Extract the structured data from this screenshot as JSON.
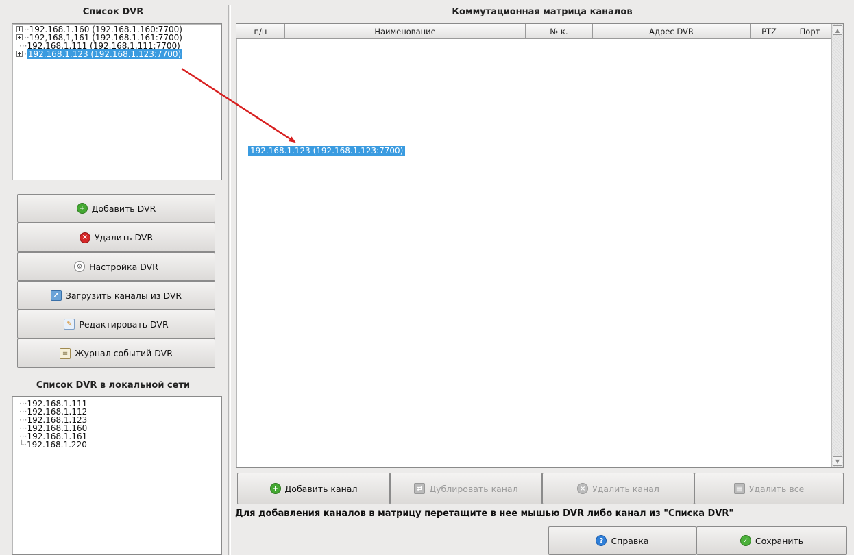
{
  "left": {
    "dvr_list_title": "Список DVR",
    "dvr_list": [
      {
        "text": "192.168.1.160 (192.168.1.160:7700)",
        "expandable": true,
        "selected": false
      },
      {
        "text": "192,168,1,161 (192.168.1.161:7700)",
        "expandable": true,
        "selected": false
      },
      {
        "text": "192,168,1,111 (192.168.1.111:7700)",
        "expandable": false,
        "selected": false
      },
      {
        "text": "192.168.1.123 (192.168.1.123:7700)",
        "expandable": true,
        "selected": true
      }
    ],
    "buttons": {
      "add": "Добавить DVR",
      "remove": "Удалить DVR",
      "settings": "Настройка DVR",
      "load_channels": "Загрузить каналы из DVR",
      "edit": "Редактировать DVR",
      "log": "Журнал событий DVR"
    },
    "local_title": "Список DVR в локальной сети",
    "local_list": [
      "192.168.1.111",
      "192.168.1.112",
      "192.168.1.123",
      "192.168.1.160",
      "192.168.1.161",
      "192.168.1.220"
    ]
  },
  "matrix": {
    "title": "Коммутационная матрица каналов",
    "columns": {
      "num": "п/н",
      "name": "Наименование",
      "channel": "№ к.",
      "address": "Адрес DVR",
      "ptz": "PTZ",
      "port": "Порт"
    },
    "drag_item": "192.168.1.123 (192.168.1.123:7700)",
    "buttons": {
      "add_channel": "Добавить канал",
      "duplicate": "Дублировать канал",
      "delete_channel": "Удалить канал",
      "delete_all": "Удалить все"
    },
    "hint": "Для добавления каналов в матрицу перетащите в нее мышью DVR либо канал из \"Списка DVR\""
  },
  "footer": {
    "help": "Справка",
    "save": "Сохранить"
  },
  "colors": {
    "selection": "#3a9be0",
    "arrow": "#d82020"
  }
}
